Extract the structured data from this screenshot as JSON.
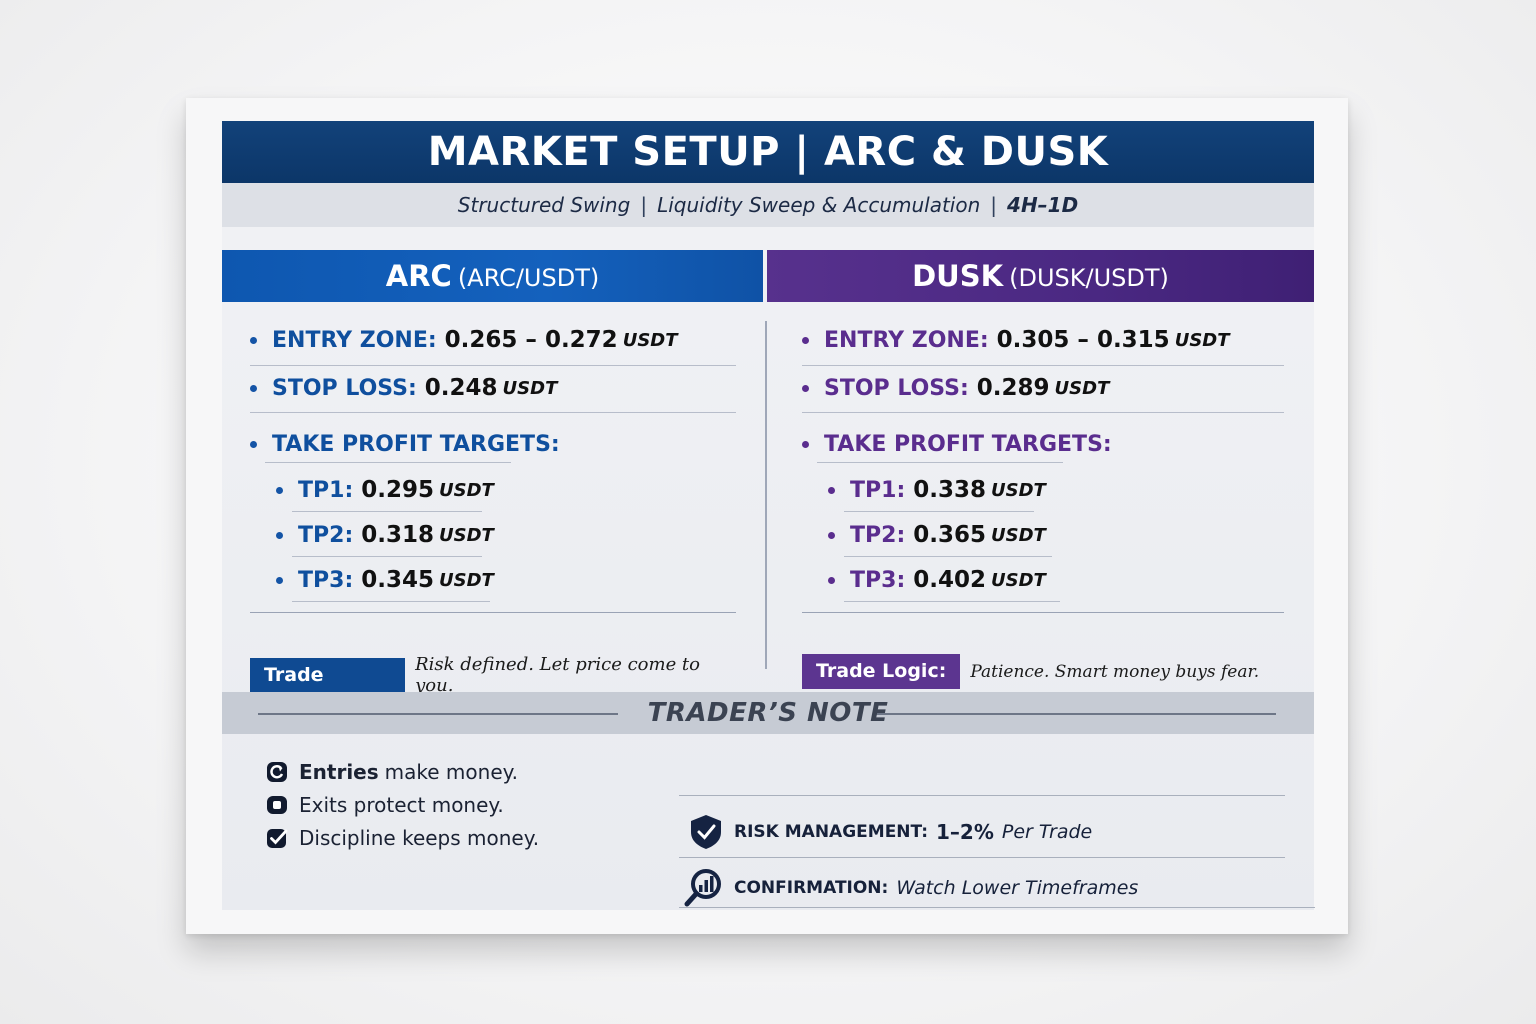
{
  "header": {
    "title": "MARKET SETUP | ARC & DUSK",
    "subtitle_parts": [
      "Structured Swing",
      "Liquidity Sweep & Accumulation",
      "4H–1D"
    ],
    "separator": "|"
  },
  "arc": {
    "code": "ARC",
    "pair": "(ARC/USDT)",
    "entry_label": "ENTRY ZONE:",
    "entry_value": "0.265 – 0.272",
    "stop_label": "STOP LOSS:",
    "stop_value": "0.248",
    "targets_label": "TAKE PROFIT TARGETS:",
    "targets": [
      {
        "label": "TP1:",
        "value": "0.295"
      },
      {
        "label": "TP2:",
        "value": "0.318"
      },
      {
        "label": "TP3:",
        "value": "0.345"
      }
    ],
    "logic_label": "Trade Logic:",
    "logic_text": "Risk defined. Let price come to you.",
    "accent": "#0f4f9e"
  },
  "dusk": {
    "code": "DUSK",
    "pair": "(DUSK/USDT)",
    "entry_label": "ENTRY ZONE:",
    "entry_value": "0.305 – 0.315",
    "stop_label": "STOP LOSS:",
    "stop_value": "0.289",
    "targets_label": "TAKE PROFIT TARGETS:",
    "targets": [
      {
        "label": "TP1:",
        "value": "0.338"
      },
      {
        "label": "TP2:",
        "value": "0.365"
      },
      {
        "label": "TP3:",
        "value": "0.402"
      }
    ],
    "logic_label": "Trade Logic:",
    "logic_text": "Patience. Smart money buys fear.",
    "accent": "#5a2d8e"
  },
  "unit": "USDT",
  "note": {
    "title": "TRADER’S NOTE",
    "maxims": [
      {
        "bold": "Entries",
        "rest": "make money.",
        "icon": "refresh-check-icon"
      },
      {
        "bold": "",
        "rest": "Exits protect money.",
        "icon": "stop-square-icon"
      },
      {
        "bold": "",
        "rest": "Discipline keeps money.",
        "icon": "checkbox-icon"
      }
    ],
    "risk_label": "RISK MANAGEMENT:",
    "risk_value": "1–2%",
    "risk_suffix": "Per Trade",
    "confirm_label": "CONFIRMATION:",
    "confirm_value": "Watch Lower Timeframes"
  },
  "icons": {
    "risk": "shield-check-icon",
    "confirm": "magnifier-chart-icon"
  }
}
